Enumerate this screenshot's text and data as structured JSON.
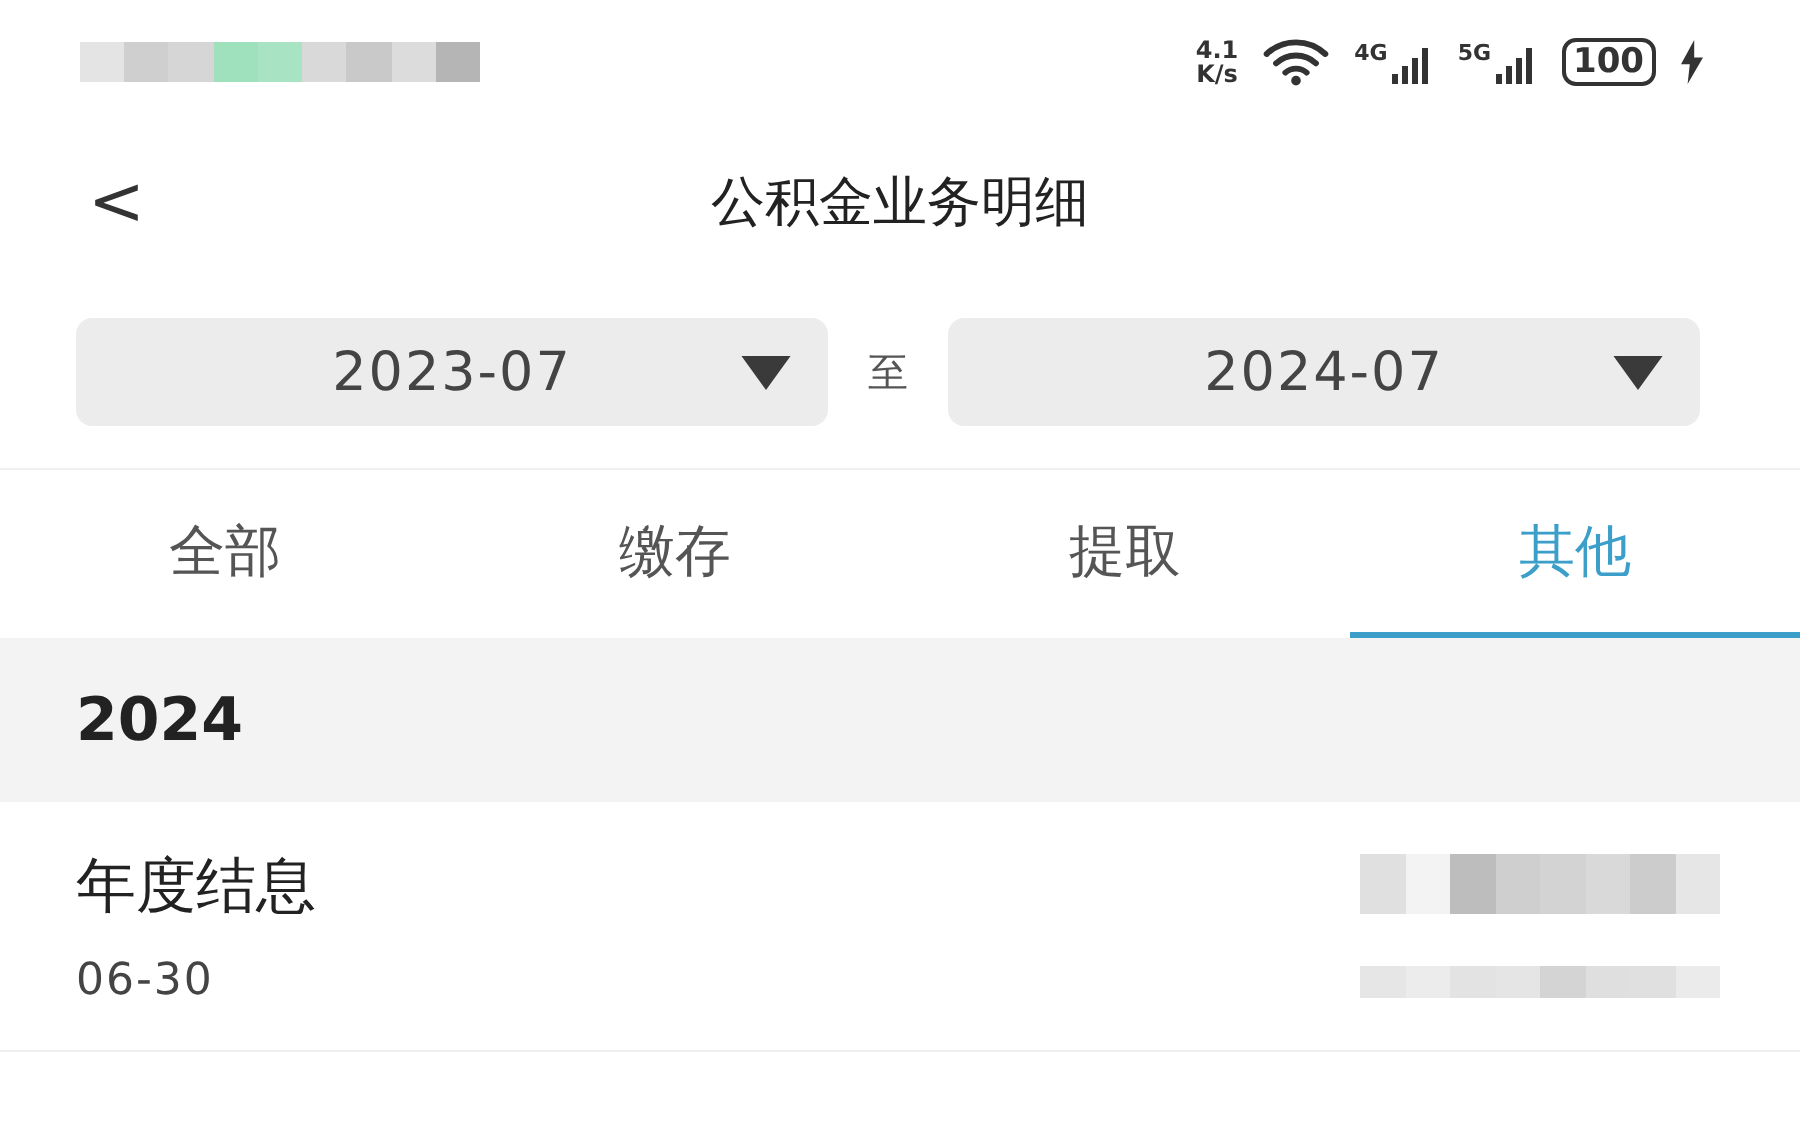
{
  "status_bar": {
    "speed_value": "4.1",
    "speed_unit": "K/s",
    "network_1": "4G",
    "network_2": "5G",
    "battery": "100"
  },
  "header": {
    "back": "<",
    "title": "公积金业务明细"
  },
  "date_range": {
    "from": "2023-07",
    "separator": "至",
    "to": "2024-07"
  },
  "tabs": [
    {
      "label": "全部",
      "selected": false
    },
    {
      "label": "缴存",
      "selected": false
    },
    {
      "label": "提取",
      "selected": false
    },
    {
      "label": "其他",
      "selected": true
    }
  ],
  "groups": [
    {
      "year": "2024",
      "records": [
        {
          "title": "年度结息",
          "date": "06-30"
        }
      ]
    }
  ]
}
